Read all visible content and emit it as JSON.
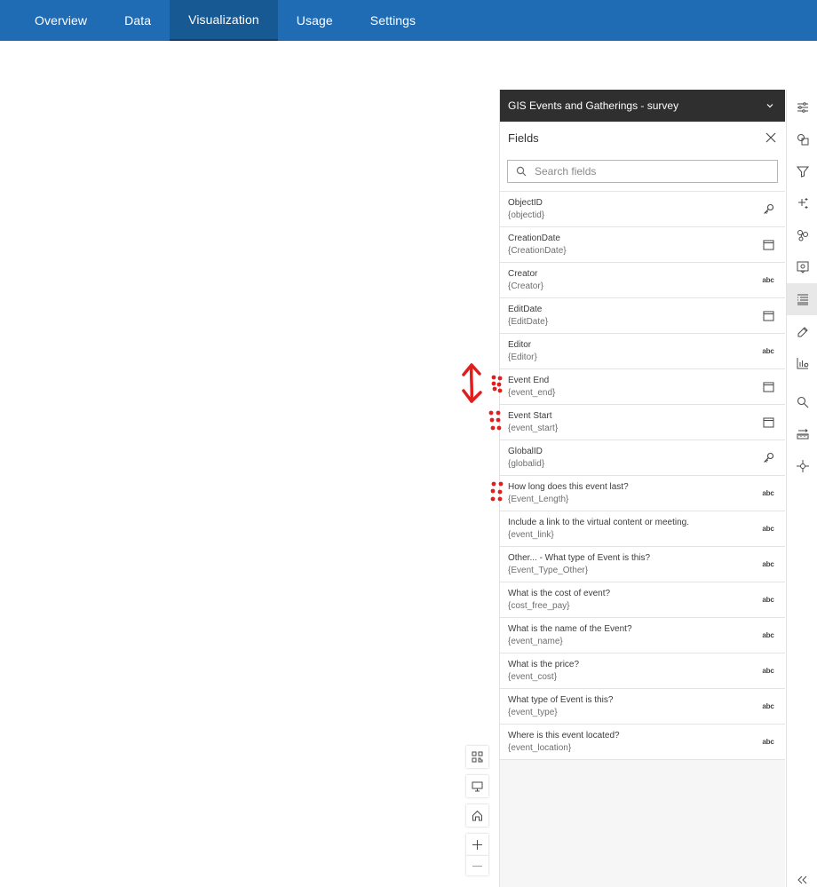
{
  "nav": {
    "tabs": [
      {
        "label": "Overview"
      },
      {
        "label": "Data"
      },
      {
        "label": "Visualization"
      },
      {
        "label": "Usage"
      },
      {
        "label": "Settings"
      }
    ],
    "active_tab": "Visualization"
  },
  "panel": {
    "layer_title": "GIS Events and Gatherings - survey",
    "fields_title": "Fields",
    "search_placeholder": "Search fields",
    "fields": [
      {
        "label": "ObjectID",
        "alias": "{objectid}",
        "icon": "key-icon"
      },
      {
        "label": "CreationDate",
        "alias": "{CreationDate}",
        "icon": "calendar-icon"
      },
      {
        "label": "Creator",
        "alias": "{Creator}",
        "icon": "abc-icon"
      },
      {
        "label": "EditDate",
        "alias": "{EditDate}",
        "icon": "calendar-icon"
      },
      {
        "label": "Editor",
        "alias": "{Editor}",
        "icon": "abc-icon"
      },
      {
        "label": "Event End",
        "alias": "{event_end}",
        "icon": "calendar-icon"
      },
      {
        "label": "Event Start",
        "alias": "{event_start}",
        "icon": "calendar-icon"
      },
      {
        "label": "GlobalID",
        "alias": "{globalid}",
        "icon": "key-icon"
      },
      {
        "label": "How long does this event last?",
        "alias": "{Event_Length}",
        "icon": "abc-icon"
      },
      {
        "label": "Include a link to the virtual content or meeting.",
        "alias": "{event_link}",
        "icon": "abc-icon"
      },
      {
        "label": "Other... - What type of Event is this?",
        "alias": "{Event_Type_Other}",
        "icon": "abc-icon"
      },
      {
        "label": "What is the cost of event?",
        "alias": "{cost_free_pay}",
        "icon": "abc-icon"
      },
      {
        "label": "What is the name of the Event?",
        "alias": "{event_name}",
        "icon": "abc-icon"
      },
      {
        "label": "What is the price?",
        "alias": "{event_cost}",
        "icon": "abc-icon"
      },
      {
        "label": "What type of Event is this?",
        "alias": "{event_type}",
        "icon": "abc-icon"
      },
      {
        "label": "Where is this event located?",
        "alias": "{event_location}",
        "icon": "abc-icon"
      }
    ],
    "abc_text": "abc"
  },
  "rail": {
    "icons": [
      "sliders-icon",
      "shapes-icon",
      "filter-icon",
      "sparkle-icon",
      "cluster-icon",
      "popup-gear-icon",
      "fields-list-icon",
      "pencil-tag-icon",
      "chart-gear-icon",
      "search-icon",
      "measure-icon",
      "crosshair-icon",
      "collapse-icon"
    ],
    "active_icon": "fields-list-icon"
  },
  "map_controls": [
    "qr-code-icon",
    "monitor-icon",
    "home-icon",
    "zoom-in-icon",
    "zoom-out-icon"
  ],
  "colors": {
    "nav_bg": "#1f6cb4",
    "nav_active": "#175993",
    "header_dark": "#2f2f2f",
    "annotation_red": "#e01e1e"
  }
}
